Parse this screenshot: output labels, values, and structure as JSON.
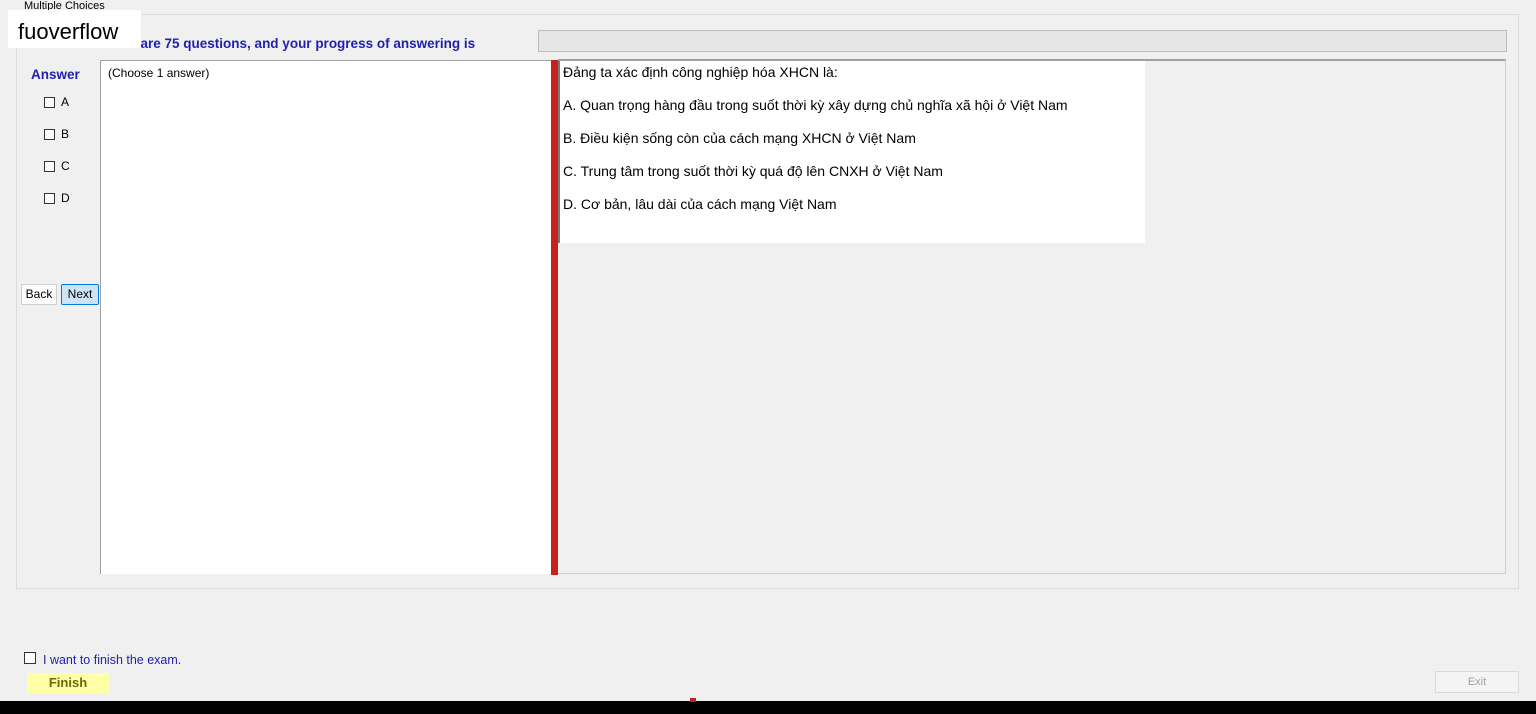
{
  "window": {
    "group_title": "Multiple Choices",
    "watermark": "fuoverflow"
  },
  "progress": {
    "text": "There are 75 questions, and your progress of answering is",
    "value": 0
  },
  "answer_panel": {
    "title": "Answer",
    "options": [
      "A",
      "B",
      "C",
      "D"
    ]
  },
  "navigation": {
    "back_label": "Back",
    "next_label": "Next"
  },
  "left_panel": {
    "instruction": "(Choose 1 answer)"
  },
  "question": {
    "stem": "Đảng ta xác định công nghiệp hóa XHCN là:",
    "choices": [
      "A.  Quan trọng hàng đầu trong suốt thời kỳ xây dựng chủ nghĩa xã hội ở Việt Nam",
      "B.  Điều kiện sống còn của cách mạng XHCN ở Việt Nam",
      "C.  Trung tâm trong suốt thời kỳ quá độ lên CNXH ở Việt Nam",
      "D.  Cơ bản, lâu dài của cách mạng Việt Nam"
    ]
  },
  "footer": {
    "finish_check_label": "I want to finish the exam.",
    "finish_label": "Finish",
    "exit_label": "Exit"
  },
  "colors": {
    "accent_text": "#1f1fae",
    "splitter": "#c81f1f",
    "finish_bg": "#ffffa8"
  }
}
